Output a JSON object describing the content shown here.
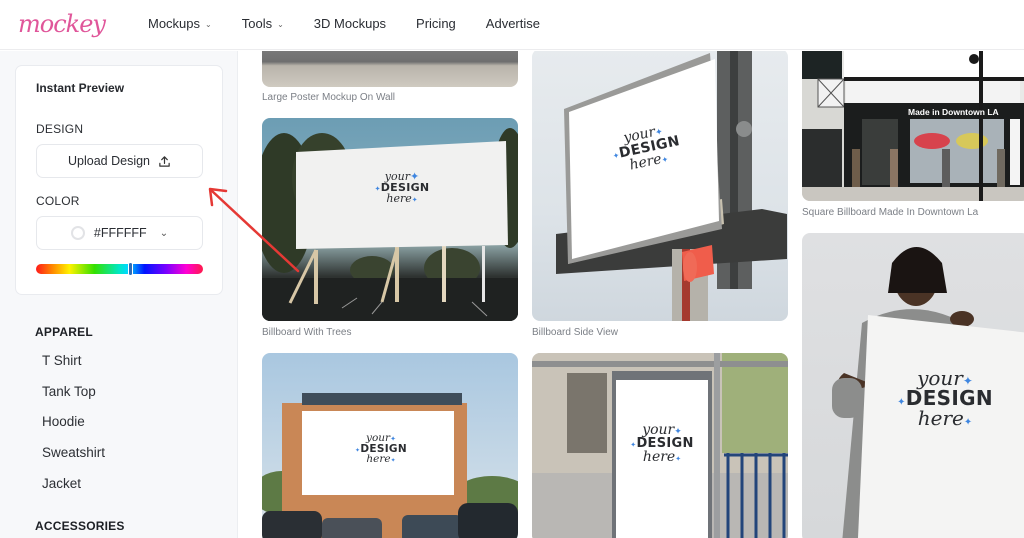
{
  "header": {
    "logo": "mockey",
    "nav": [
      {
        "label": "Mockups",
        "has_dropdown": true
      },
      {
        "label": "Tools",
        "has_dropdown": true
      },
      {
        "label": "3D Mockups",
        "has_dropdown": false
      },
      {
        "label": "Pricing",
        "has_dropdown": false
      },
      {
        "label": "Advertise",
        "has_dropdown": false
      }
    ]
  },
  "sidebar": {
    "panel": {
      "title": "Instant Preview",
      "design_label": "DESIGN",
      "upload_button": "Upload Design",
      "upload_icon": "upload-icon",
      "color_label": "COLOR",
      "color_value": "#FFFFFF",
      "swatch_color": "#FFFFFF",
      "hue_position": 0.57
    },
    "categories": [
      {
        "heading": "APPAREL",
        "items": [
          "T Shirt",
          "Tank Top",
          "Hoodie",
          "Sweatshirt",
          "Jacket"
        ]
      },
      {
        "heading": "ACCESSORIES",
        "items": []
      }
    ]
  },
  "mockups": {
    "placeholder": {
      "your": "your",
      "design": "DESIGN",
      "here": "here"
    },
    "cards": [
      {
        "caption": "Large Poster Mockup On Wall"
      },
      {
        "caption": "Billboard With Trees"
      },
      {
        "caption": "Billboard Side View"
      },
      {
        "caption": "Square Billboard Made In Downtown La",
        "sign_text": "Made in Downtown LA"
      },
      {
        "caption": ""
      },
      {
        "caption": ""
      },
      {
        "caption": ""
      }
    ]
  },
  "annotation": {
    "arrow_color": "#e53935"
  }
}
